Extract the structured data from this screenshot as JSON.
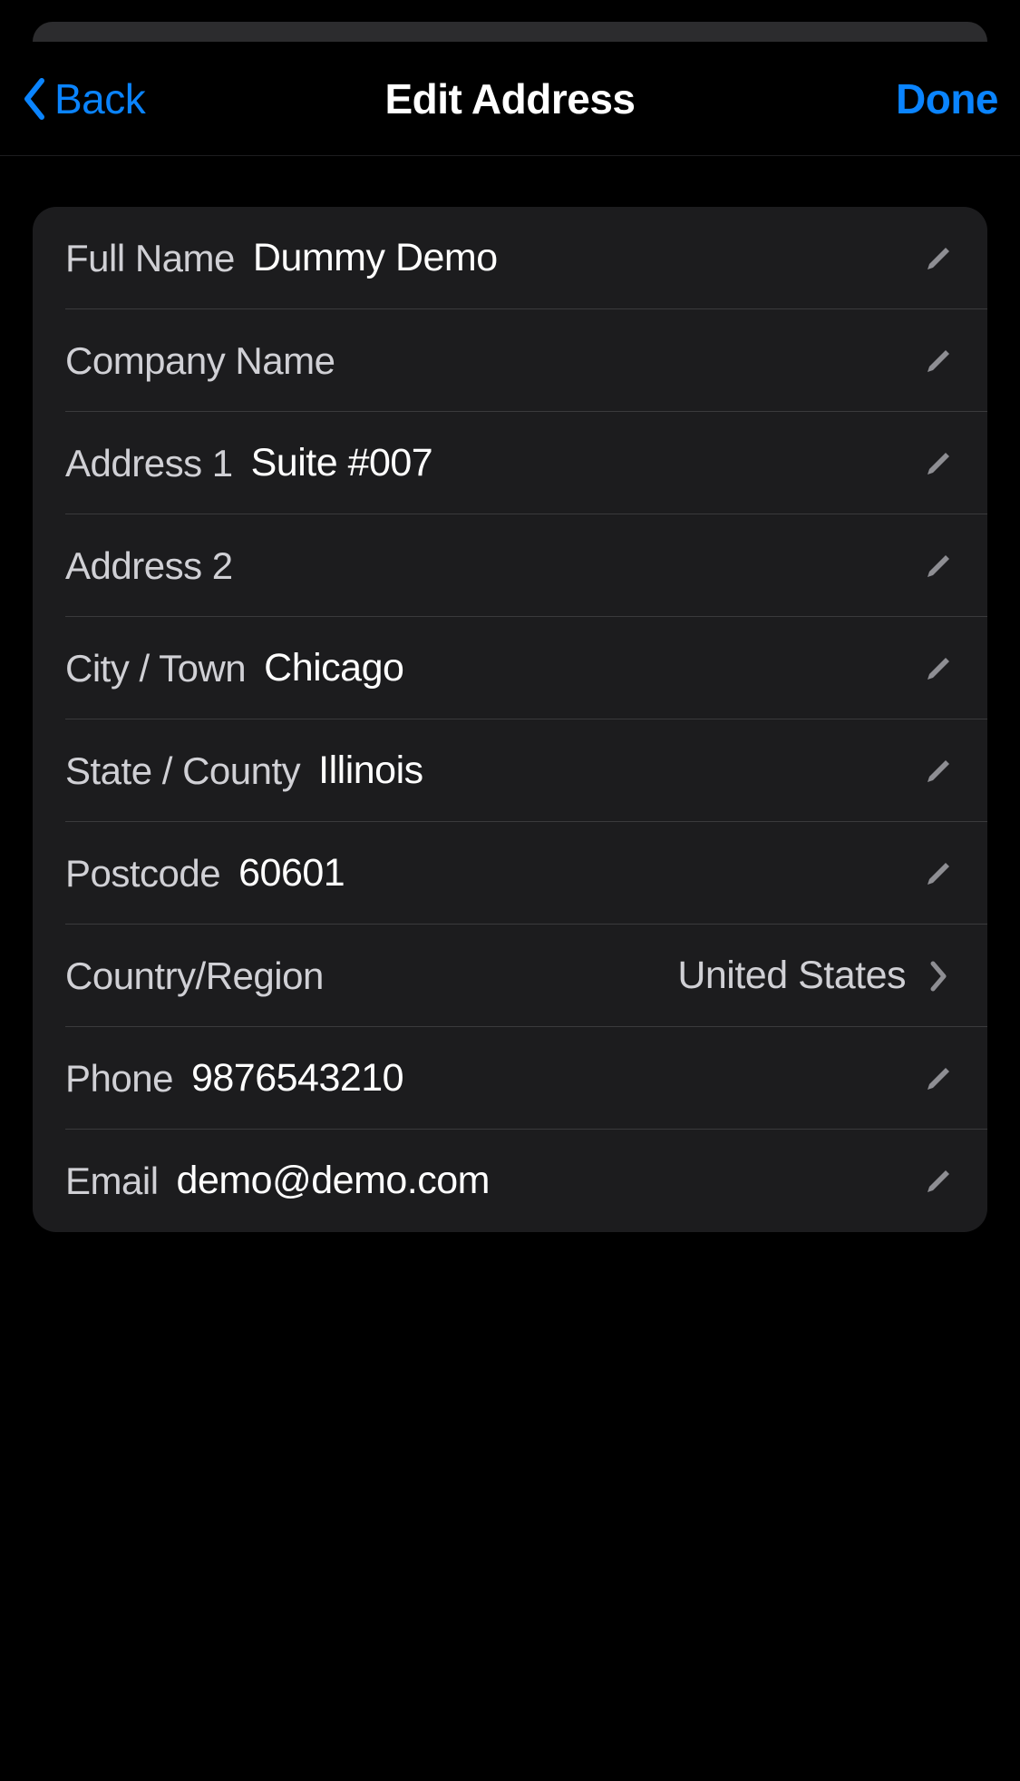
{
  "nav": {
    "back_label": "Back",
    "title": "Edit Address",
    "done_label": "Done"
  },
  "form": {
    "full_name": {
      "label": "Full Name",
      "value": "Dummy Demo"
    },
    "company_name": {
      "label": "Company Name",
      "value": ""
    },
    "address_1": {
      "label": "Address 1",
      "value": "Suite #007"
    },
    "address_2": {
      "label": "Address 2",
      "value": ""
    },
    "city": {
      "label": "City / Town",
      "value": "Chicago"
    },
    "state": {
      "label": "State / County",
      "value": "Illinois"
    },
    "postcode": {
      "label": "Postcode",
      "value": "60601"
    },
    "country": {
      "label": "Country/Region",
      "value": "United States"
    },
    "phone": {
      "label": "Phone",
      "value": "9876543210"
    },
    "email": {
      "label": "Email",
      "value": "demo@demo.com"
    }
  },
  "colors": {
    "accent": "#0a84ff",
    "background": "#000000",
    "card": "#1c1c1e",
    "separator": "#3a3a3c",
    "text_primary": "#ffffff",
    "text_secondary": "#d0d0d5",
    "icon_secondary": "#8e8e93"
  }
}
